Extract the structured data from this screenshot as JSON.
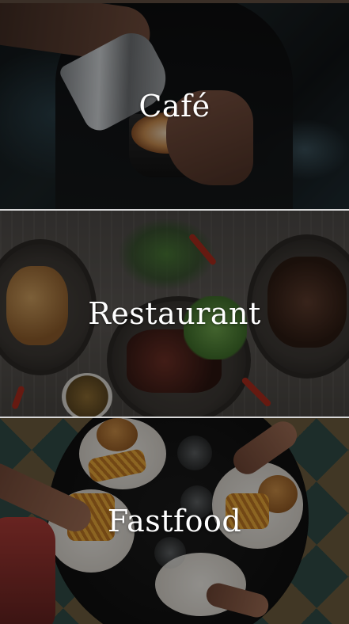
{
  "categories": [
    {
      "id": "cafe",
      "label": "Café"
    },
    {
      "id": "restaurant",
      "label": "Restaurant"
    },
    {
      "id": "fastfood",
      "label": "Fastfood"
    }
  ]
}
